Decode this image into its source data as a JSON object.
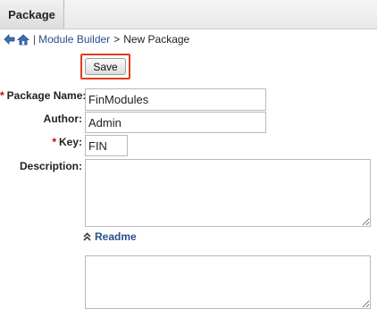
{
  "tabs": [
    {
      "label": "Package"
    }
  ],
  "breadcrumb": {
    "separator": "|",
    "link": "Module Builder",
    "arrow": ">",
    "current": "New Package",
    "icons": [
      "back-arrow-icon",
      "home-icon"
    ]
  },
  "toolbar": {
    "save_label": "Save",
    "highlight_color": "#e23a1c"
  },
  "form": {
    "required_marker": "*",
    "package_name": {
      "label": "Package Name:",
      "value": "FinModules",
      "required": true
    },
    "author": {
      "label": "Author:",
      "value": "Admin",
      "required": false
    },
    "key": {
      "label": "Key:",
      "value": "FIN",
      "required": true
    },
    "description": {
      "label": "Description:",
      "value": ""
    },
    "readme": {
      "label": "Readme",
      "value": "",
      "icon": "double-chevron-up-icon"
    }
  },
  "colors": {
    "link": "#2a4f8a",
    "required": "#c00000"
  }
}
